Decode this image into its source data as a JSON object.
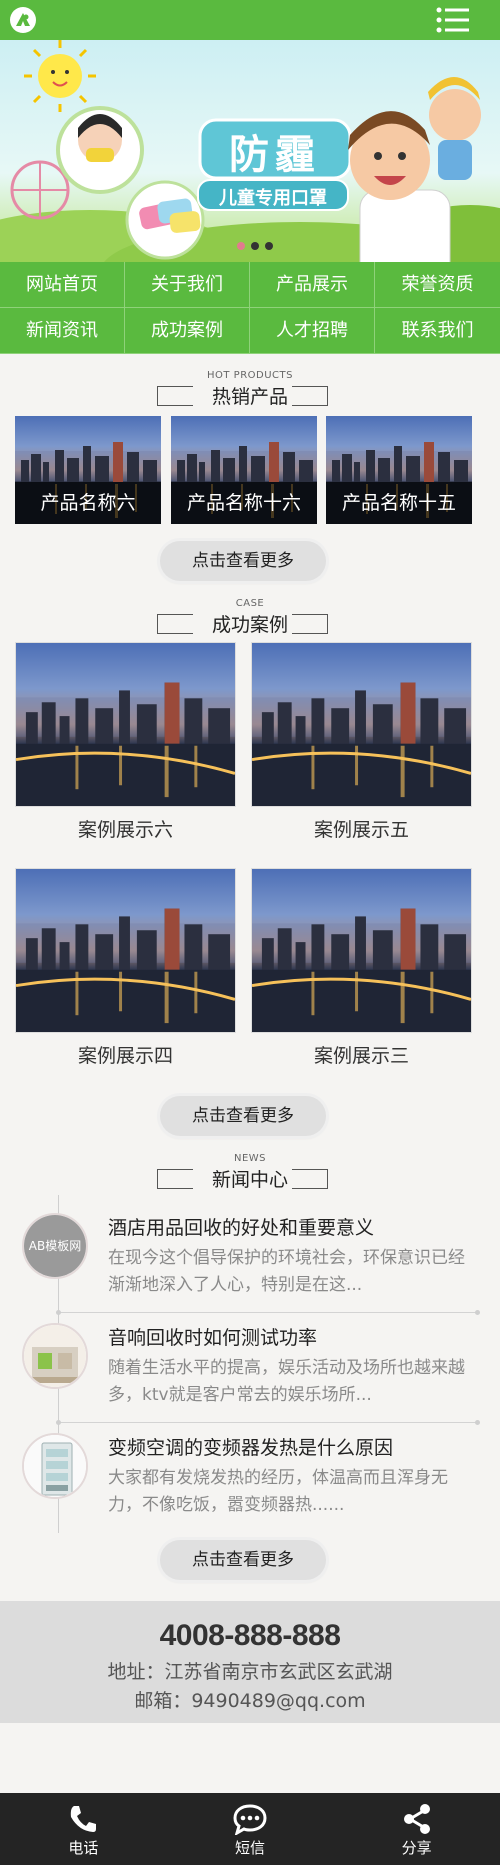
{
  "header": {
    "logo_icon": "logo-circle-icon",
    "menu_icon": "menu-list-icon",
    "accent": "#5aba3f"
  },
  "banner": {
    "title": "防霾",
    "subtitle": "儿童专用口罩",
    "slide_count": 3,
    "active_slide": 1
  },
  "nav": [
    {
      "label": "网站首页"
    },
    {
      "label": "关于我们"
    },
    {
      "label": "产品展示"
    },
    {
      "label": "荣誉资质"
    },
    {
      "label": "新闻资讯"
    },
    {
      "label": "成功案例"
    },
    {
      "label": "人才招聘"
    },
    {
      "label": "联系我们"
    }
  ],
  "products": {
    "en_title": "HOT PRODUCTS",
    "title": "热销产品",
    "items": [
      {
        "name": "产品名称六"
      },
      {
        "name": "产品名称十六"
      },
      {
        "name": "产品名称十五"
      }
    ],
    "more": "点击查看更多"
  },
  "cases": {
    "en_title": "CASE",
    "title": "成功案例",
    "items": [
      {
        "name": "案例展示六"
      },
      {
        "name": "案例展示五"
      },
      {
        "name": "案例展示四"
      },
      {
        "name": "案例展示三"
      }
    ],
    "more": "点击查看更多"
  },
  "news": {
    "en_title": "NEWS",
    "title": "新闻中心",
    "items": [
      {
        "title": "酒店用品回收的好处和重要意义",
        "desc": "在现今这个倡导保护的环境社会，环保意识已经渐渐地深入了人心，特别是在这...",
        "thumb_text": "AB模板网"
      },
      {
        "title": "音响回收时如何测试功率",
        "desc": "随着生活水平的提高，娱乐活动及场所也越来越多，ktv就是客户常去的娱乐场所...",
        "thumb_text": ""
      },
      {
        "title": "变频空调的变频器发热是什么原因",
        "desc": "大家都有发烧发热的经历，体温高而且浑身无力，不像吃饭，嚣变频器热......",
        "thumb_text": ""
      }
    ],
    "more": "点击查看更多"
  },
  "contact": {
    "phone": "4008-888-888",
    "address": "地址：江苏省南京市玄武区玄武湖",
    "email": "邮箱：9490489@qq.com"
  },
  "footer": [
    {
      "label": "电话",
      "icon": "phone-icon"
    },
    {
      "label": "短信",
      "icon": "sms-icon"
    },
    {
      "label": "分享",
      "icon": "share-icon"
    }
  ]
}
